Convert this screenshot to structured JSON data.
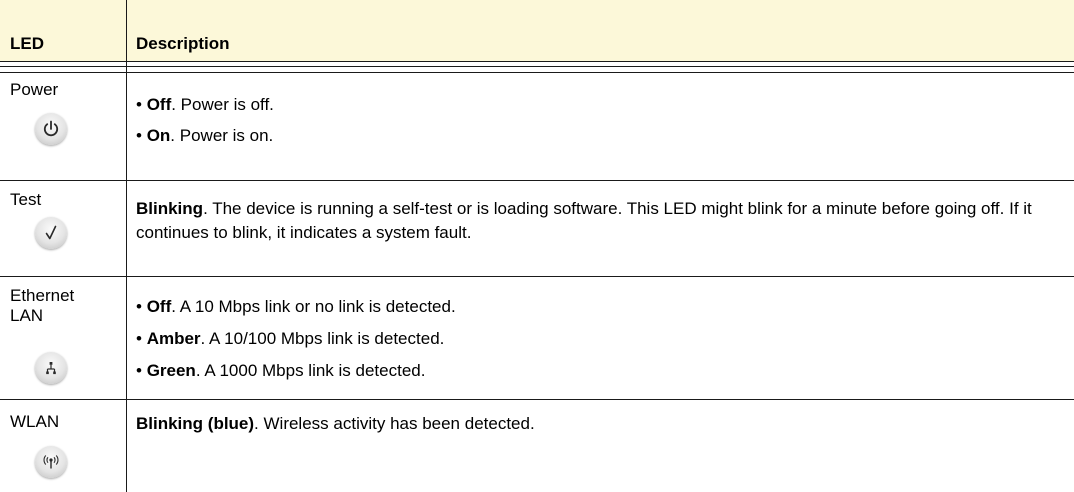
{
  "table": {
    "headers": {
      "led": "LED",
      "description": "Description"
    },
    "rows": [
      {
        "led": "Power",
        "icon": "power-icon",
        "items": [
          {
            "term": "Off",
            "text": ". Power is off."
          },
          {
            "term": "On",
            "text": ". Power is on."
          }
        ]
      },
      {
        "led": "Test",
        "icon": "checkmark-icon",
        "paragraph": {
          "term": "Blinking",
          "text": ". The device is running a self-test or is loading software. This LED might blink for a minute before going off. If it continues to blink, it indicates a system fault."
        }
      },
      {
        "led_lines": [
          "Ethernet",
          "LAN"
        ],
        "icon": "network-icon",
        "items": [
          {
            "term": "Off",
            "text": ". A 10 Mbps link or no link is detected."
          },
          {
            "term": "Amber",
            "text": ". A 10/100 Mbps link is detected."
          },
          {
            "term": "Green",
            "text": ". A 1000 Mbps link is detected."
          }
        ]
      },
      {
        "led": "WLAN",
        "icon": "wireless-antenna-icon",
        "paragraph": {
          "term": "Blinking (blue)",
          "text": ". Wireless activity has been detected."
        }
      }
    ],
    "bullet": "•"
  }
}
